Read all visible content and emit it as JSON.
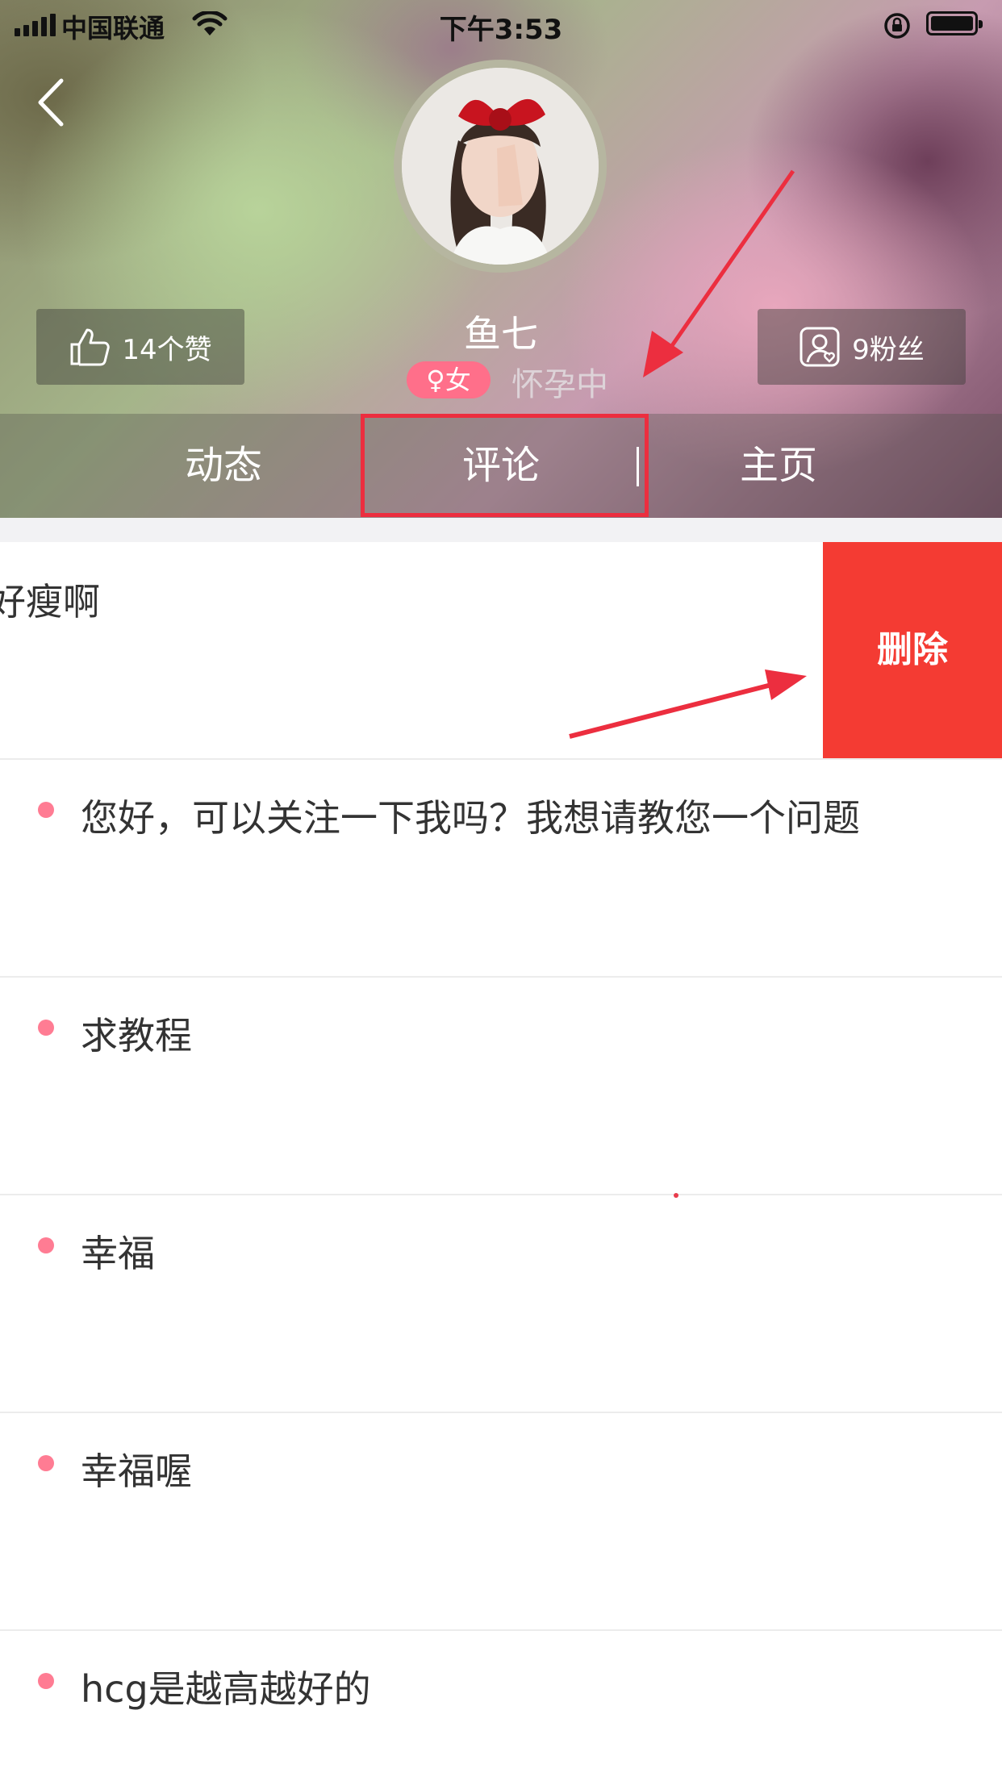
{
  "status_bar": {
    "carrier": "中国联通",
    "time": "下午3:53"
  },
  "profile": {
    "name": "鱼七",
    "gender": "♀女",
    "status": "怀孕中",
    "likes": "14个赞",
    "fans": "9粉丝"
  },
  "tabs": [
    "动态",
    "评论",
    "主页"
  ],
  "comments": {
    "first_partial": "好瘦啊",
    "delete_label": "删除",
    "items": [
      "您好，可以关注一下我吗？我想请教您一个问题",
      "求教程",
      "幸福",
      "幸福喔",
      "hcg是越高越好的"
    ]
  },
  "colors": {
    "accent_pink": "#ff7c93",
    "delete_red": "#f43b33",
    "annotation_red": "#ec2e3f"
  }
}
